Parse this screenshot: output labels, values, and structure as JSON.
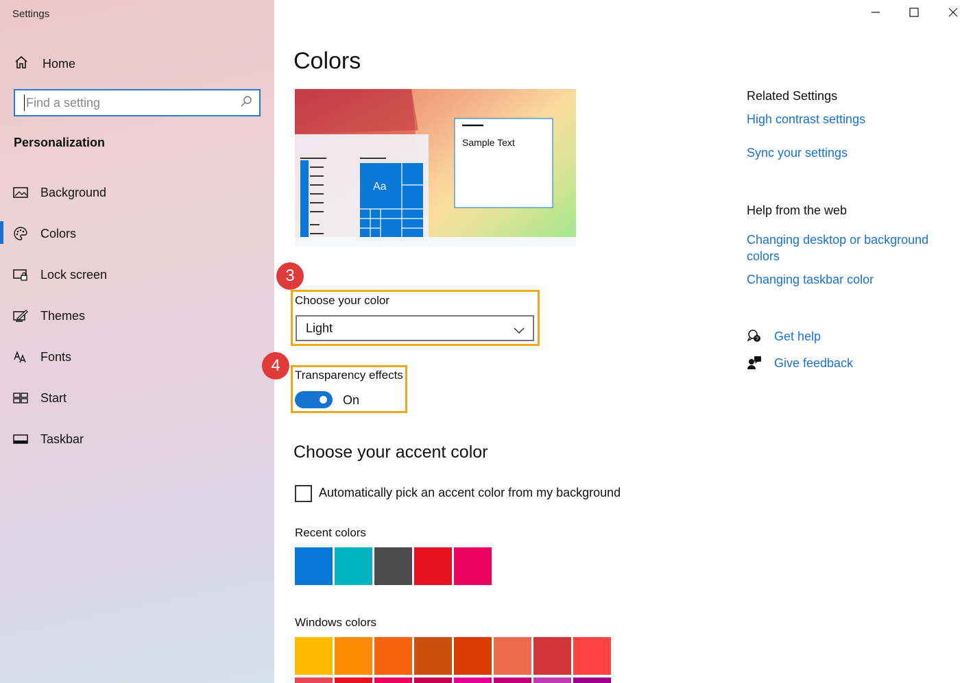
{
  "window": {
    "title": "Settings"
  },
  "sidebar": {
    "home_label": "Home",
    "search_placeholder": "Find a setting",
    "section_title": "Personalization",
    "items": [
      {
        "label": "Background",
        "icon": "picture-icon"
      },
      {
        "label": "Colors",
        "icon": "palette-icon",
        "active": true
      },
      {
        "label": "Lock screen",
        "icon": "lock-screen-icon"
      },
      {
        "label": "Themes",
        "icon": "themes-icon"
      },
      {
        "label": "Fonts",
        "icon": "fonts-icon"
      },
      {
        "label": "Start",
        "icon": "start-icon"
      },
      {
        "label": "Taskbar",
        "icon": "taskbar-icon"
      }
    ]
  },
  "main": {
    "title": "Colors",
    "preview": {
      "sample_text": "Sample Text",
      "tile_text": "Aa"
    },
    "badges": [
      "3",
      "4"
    ],
    "choose_color": {
      "label": "Choose your color",
      "value": "Light"
    },
    "transparency": {
      "label": "Transparency effects",
      "state": "On",
      "enabled": true
    },
    "accent": {
      "title": "Choose your accent color",
      "auto_pick_label": "Automatically pick an accent color from my background",
      "auto_pick_checked": false,
      "recent_label": "Recent colors",
      "recent_colors": [
        "#0a78d7",
        "#00b4c2",
        "#4b4b4b",
        "#e81123",
        "#ea005e"
      ],
      "windows_label": "Windows colors",
      "windows_colors": [
        "#ffb900",
        "#ff8c00",
        "#f7630c",
        "#ca5010",
        "#da3b01",
        "#ef6950",
        "#d13438",
        "#ff4343"
      ],
      "windows_colors_row2": [
        "#e74856",
        "#e81123",
        "#ea005e",
        "#c30052",
        "#e3008c",
        "#bf0077",
        "#c239b3",
        "#9a0089"
      ]
    }
  },
  "right": {
    "related_title": "Related Settings",
    "related_links": [
      "High contrast settings",
      "Sync your settings"
    ],
    "help_title": "Help from the web",
    "help_link_1a": "Changing desktop or background",
    "help_link_1b": "colors",
    "help_link_2": "Changing taskbar color",
    "get_help": "Get help",
    "give_feedback": "Give feedback"
  },
  "colors": {
    "accent": "#1573d1",
    "link": "#1a73d0",
    "highlight": "#f0a818",
    "badge": "#e03a3a"
  }
}
